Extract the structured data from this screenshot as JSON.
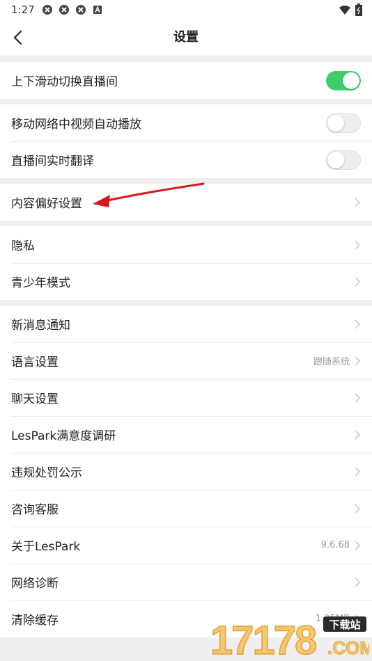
{
  "status_bar": {
    "time": "1:27"
  },
  "header": {
    "title": "设置"
  },
  "groups": [
    {
      "rows": [
        {
          "label": "上下滑动切换直播间",
          "toggle": "on"
        }
      ]
    },
    {
      "rows": [
        {
          "label": "移动网络中视频自动播放",
          "toggle": "off"
        },
        {
          "label": "直播间实时翻译",
          "toggle": "off"
        }
      ]
    },
    {
      "rows": [
        {
          "label": "内容偏好设置"
        }
      ]
    },
    {
      "rows": [
        {
          "label": "隐私"
        },
        {
          "label": "青少年模式"
        }
      ]
    },
    {
      "rows": [
        {
          "label": "新消息通知"
        },
        {
          "label": "语言设置",
          "value": "跟随系统"
        },
        {
          "label": "聊天设置"
        },
        {
          "label": "LesPark满意度调研"
        },
        {
          "label": "违规处罚公示"
        },
        {
          "label": "咨询客服"
        },
        {
          "label": "关于LesPark",
          "value": "9.6.68"
        },
        {
          "label": "网络诊断"
        },
        {
          "label": "清除缓存",
          "value": "1.25MB"
        }
      ]
    }
  ],
  "watermark": {
    "number": "17178",
    "tag": "下载站",
    "domain": ".COM"
  },
  "colors": {
    "toggle_on": "#3fcc6a",
    "annotation_arrow": "#d8161c"
  }
}
